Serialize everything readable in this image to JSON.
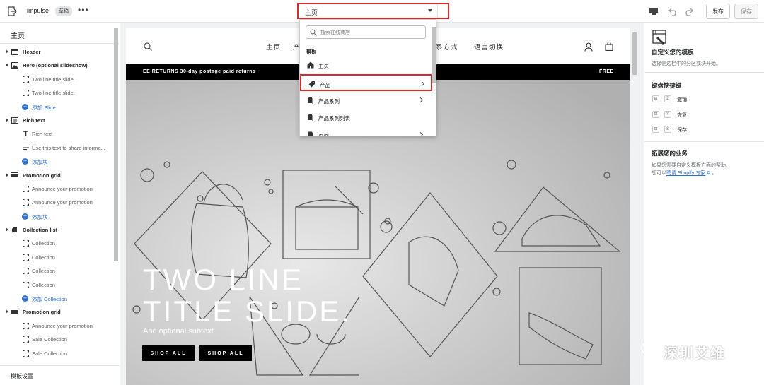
{
  "topbar": {
    "store_name": "impulse",
    "badge": "草稿",
    "more": "•••",
    "template_select": "主页",
    "publish_label": "发布",
    "save_label": "保存"
  },
  "left_panel": {
    "title": "主页",
    "sections": [
      {
        "label": "Header",
        "icon": "header-icon",
        "children": []
      },
      {
        "label": "Hero (optional slideshow)",
        "icon": "image-icon",
        "children": [
          {
            "label": "Two line title slide.",
            "type": "block"
          },
          {
            "label": "Two line title slide.",
            "type": "block"
          },
          {
            "label": "添加 Slide",
            "type": "add"
          }
        ]
      },
      {
        "label": "Rich text",
        "icon": "text-icon",
        "children": [
          {
            "label": "Rich text",
            "type": "text"
          },
          {
            "label": "Use this text to share informa...",
            "type": "lines"
          },
          {
            "label": "添加块",
            "type": "add"
          }
        ]
      },
      {
        "label": "Promotion grid",
        "icon": "grid-icon",
        "children": [
          {
            "label": "Announce your promotion",
            "type": "block"
          },
          {
            "label": "Announce your promotion",
            "type": "block"
          },
          {
            "label": "添加块",
            "type": "add"
          }
        ]
      },
      {
        "label": "Collection list",
        "icon": "collection-icon",
        "children": [
          {
            "label": "Collection",
            "type": "block"
          },
          {
            "label": "Collection",
            "type": "block"
          },
          {
            "label": "Collection",
            "type": "block"
          },
          {
            "label": "Collection",
            "type": "block"
          },
          {
            "label": "添加 Collection",
            "type": "add"
          }
        ]
      },
      {
        "label": "Promotion grid",
        "icon": "grid-icon",
        "children": [
          {
            "label": "Announce your promotion",
            "type": "block"
          },
          {
            "label": "Sale Collection",
            "type": "block"
          },
          {
            "label": "Sale Collection",
            "type": "block"
          }
        ]
      }
    ],
    "footer": "模板设置"
  },
  "preview": {
    "nav": [
      "主页",
      "产",
      "系方式",
      "语言切换"
    ],
    "announcement_left": "EE RETURNS  30-day postage paid returns",
    "announcement_right": "FREE",
    "hero_title_1": "TWO LINE",
    "hero_title_2": "TITLE SLIDE.",
    "hero_subtitle": "And optional subtext",
    "btn1": "SHOP ALL",
    "btn2": "SHOP ALL"
  },
  "dropdown": {
    "search_placeholder": "搜索在线商店",
    "group": "模板",
    "items": [
      {
        "label": "主页",
        "icon": "home-icon",
        "chevron": false
      },
      {
        "label": "产品",
        "icon": "tag-icon",
        "chevron": true
      },
      {
        "label": "产品系列",
        "icon": "collections-icon",
        "chevron": true
      },
      {
        "label": "产品系列列表",
        "icon": "collections-icon",
        "chevron": false
      },
      {
        "label": "页面",
        "icon": "page-icon",
        "chevron": true
      }
    ]
  },
  "right_panel": {
    "customize_title": "自定义您的模板",
    "customize_desc": "选择侧边栏中的分区或块开始。",
    "shortcuts_title": "键盘快捷键",
    "shortcuts": [
      {
        "key": "Z",
        "label": "撤销"
      },
      {
        "key": "Y",
        "label": "恢复"
      },
      {
        "key": "S",
        "label": "保存"
      }
    ],
    "grow_title": "拓展您的业务",
    "grow_desc_1": "如果您需要自定义模板方面的帮助,",
    "grow_desc_2_a": "您可以",
    "grow_desc_2_link": "聘请 Shopify 专家",
    "grow_desc_2_b": "。"
  },
  "watermark": "深圳艾维",
  "colors": {
    "accent": "#2c6ecb",
    "highlight": "#d82c2c",
    "hero_bg": "#b8b8b8"
  }
}
